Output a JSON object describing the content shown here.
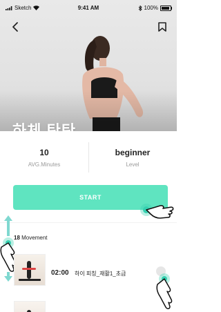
{
  "status": {
    "carrier": "Sketch",
    "time": "9:41 AM",
    "battery": "100%"
  },
  "hero": {
    "title": "하체 탄탄"
  },
  "stats": {
    "minutes": {
      "value": "10",
      "label": "AVG.Minutes"
    },
    "level": {
      "value": "beginner",
      "label": "Level"
    }
  },
  "start_button": {
    "label": "START"
  },
  "movement": {
    "count": "18",
    "label": "Movement",
    "items": [
      {
        "duration": "02:00",
        "name": "하이 피칭_재활1_초급"
      }
    ]
  },
  "icons": {
    "back": "chevron-left-icon",
    "bookmark": "bookmark-icon",
    "more": "more-options-icon"
  },
  "colors": {
    "accent": "#5fe4c0",
    "gesture_teal": "#36d0b0"
  }
}
